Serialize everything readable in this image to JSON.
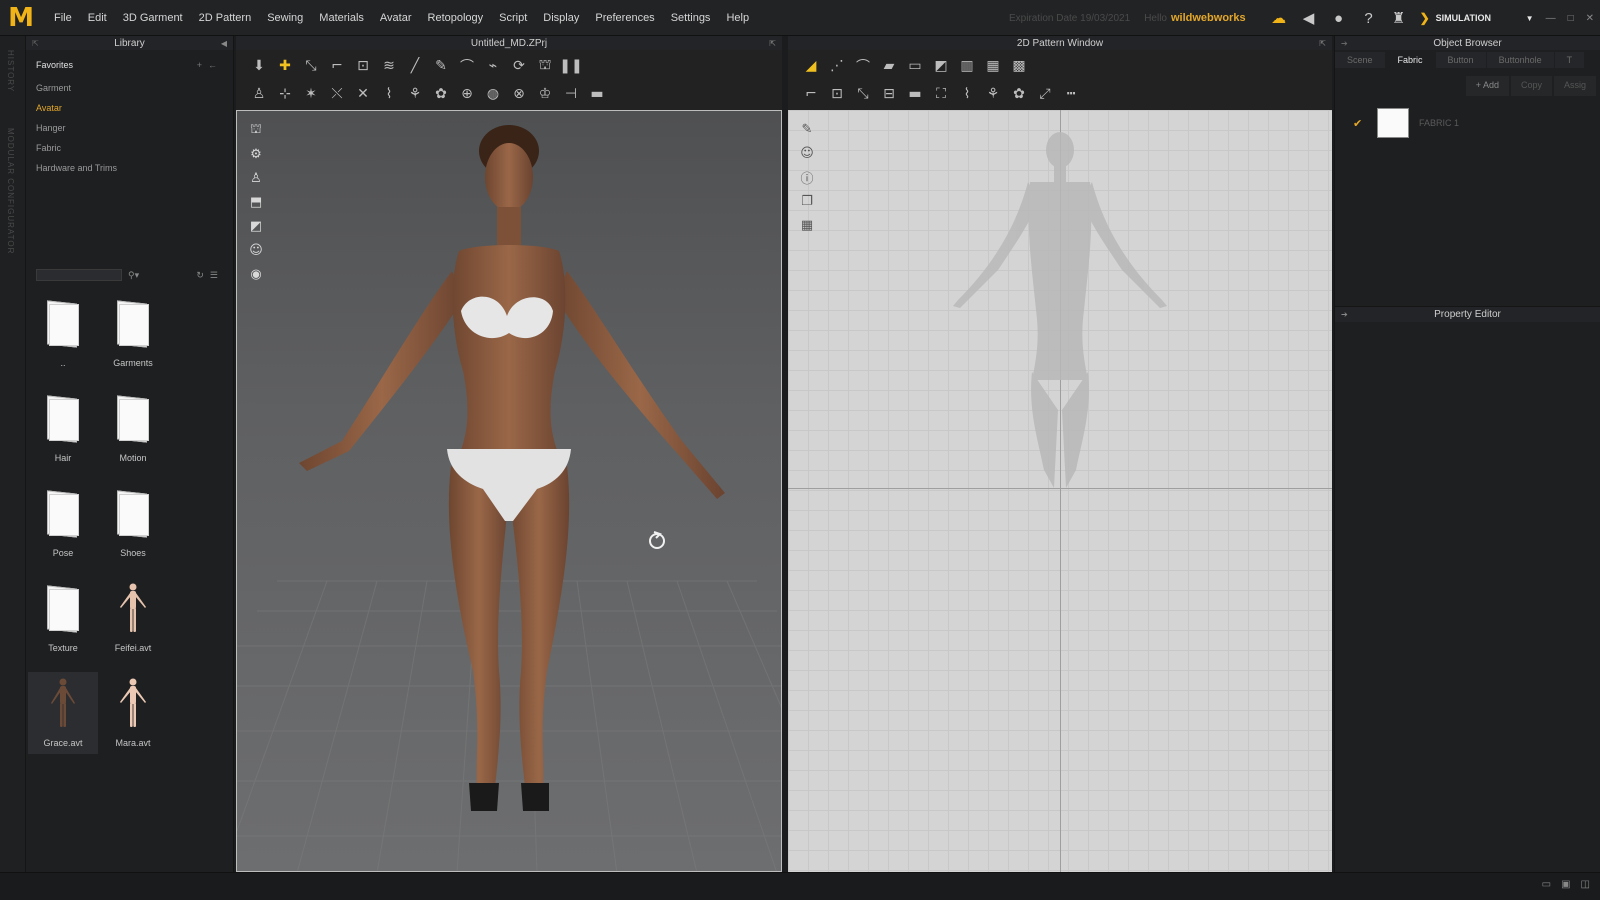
{
  "app": {
    "logo": "M",
    "menu": [
      "File",
      "Edit",
      "3D Garment",
      "2D Pattern",
      "Sewing",
      "Materials",
      "Avatar",
      "Retopology",
      "Script",
      "Display",
      "Preferences",
      "Settings",
      "Help"
    ],
    "expiration": "Expiration Date 19/03/2021",
    "hello": "Hello",
    "user": "wildwebworks",
    "mode": "SIMULATION",
    "accent": "#f0b418"
  },
  "history_strip": {
    "history_label": "HISTORY",
    "modular_label": "MODULAR CONFIGURATOR"
  },
  "library": {
    "title": "Library",
    "favorites": "Favorites",
    "tree": [
      "Garment",
      "Avatar",
      "Hanger",
      "Fabric",
      "Hardware and Trims"
    ],
    "active_index": 1,
    "items": [
      {
        "label": "..",
        "type": "folder"
      },
      {
        "label": "Garments",
        "type": "folder"
      },
      {
        "label": "Hair",
        "type": "folder"
      },
      {
        "label": "Motion",
        "type": "folder"
      },
      {
        "label": "Pose",
        "type": "folder"
      },
      {
        "label": "Shoes",
        "type": "folder"
      },
      {
        "label": "Texture",
        "type": "folder"
      },
      {
        "label": "Feifei.avt",
        "type": "avatar"
      },
      {
        "label": "Grace.avt",
        "type": "avatar"
      },
      {
        "label": "Mara.avt",
        "type": "avatar"
      }
    ]
  },
  "viewport3d": {
    "title": "Untitled_MD.ZPrj"
  },
  "viewport2d": {
    "title": "2D Pattern Window"
  },
  "object_browser": {
    "title": "Object Browser",
    "tabs": [
      "Scene",
      "Fabric",
      "Button",
      "Buttonhole",
      "T"
    ],
    "active_tab": 1,
    "add": "+ Add",
    "copy": "Copy",
    "assign": "Assig",
    "fabric_name": "FABRIC 1",
    "fabric_color": "#fafafa"
  },
  "property_editor": {
    "title": "Property Editor"
  }
}
